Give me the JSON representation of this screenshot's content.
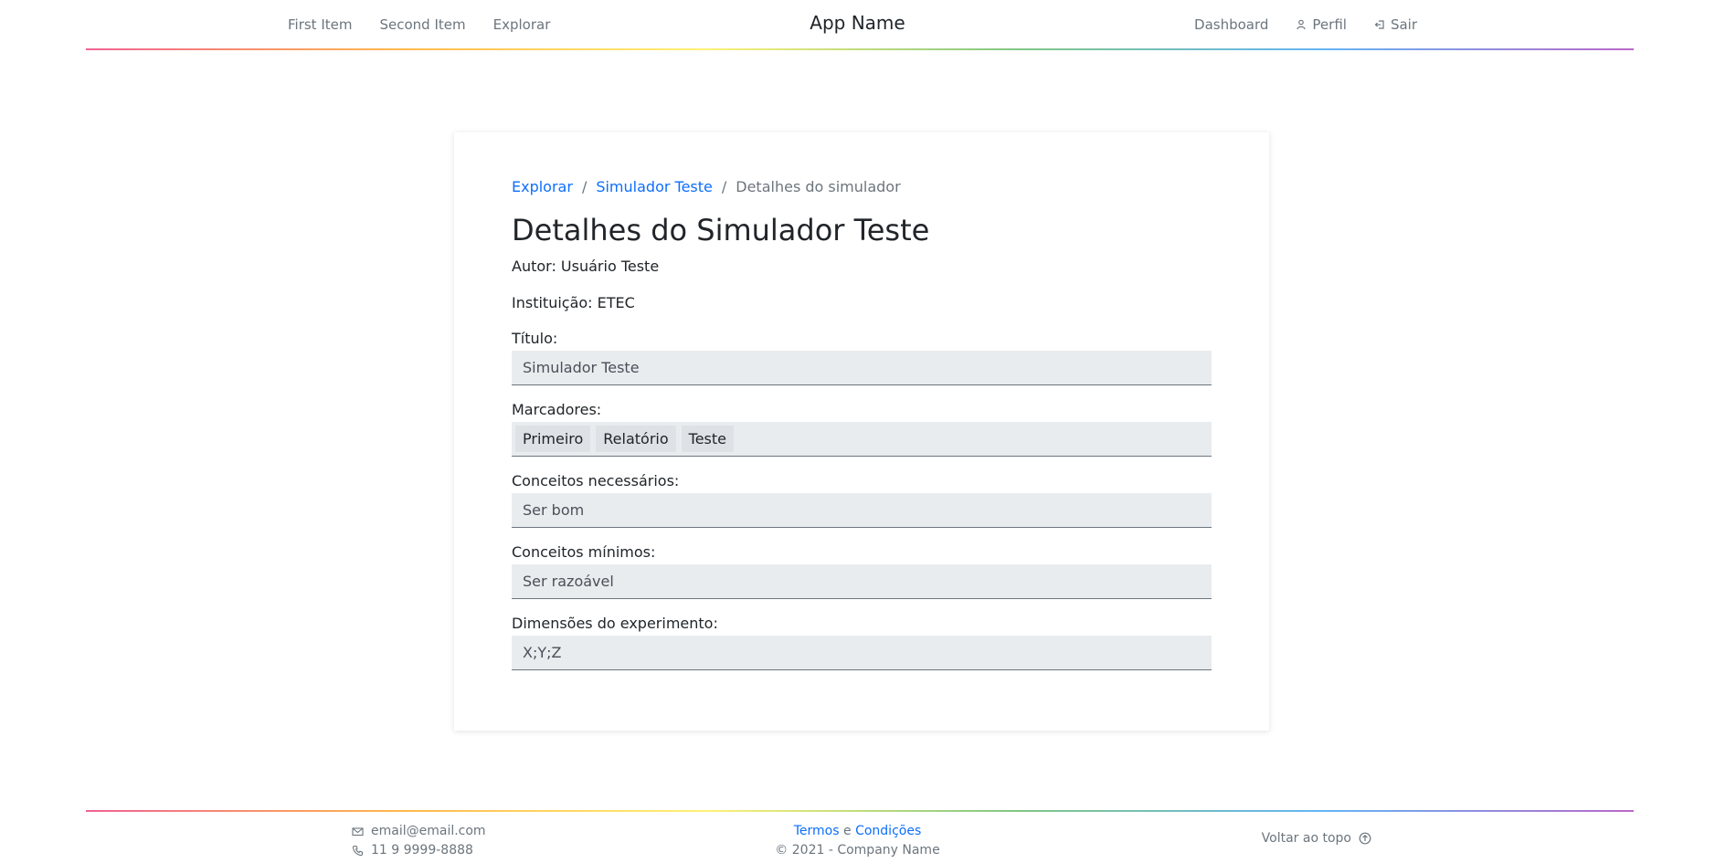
{
  "header": {
    "nav_left": [
      "First Item",
      "Second Item",
      "Explorar"
    ],
    "brand": "App Name",
    "nav_right": {
      "dashboard": "Dashboard",
      "profile": "Perfil",
      "logout": "Sair"
    }
  },
  "breadcrumb": {
    "items": [
      "Explorar",
      "Simulador Teste"
    ],
    "current": "Detalhes do simulador",
    "separator": "/"
  },
  "page": {
    "title": "Detalhes do Simulador Teste",
    "author": "Autor: Usuário Teste",
    "institution": "Instituição: ETEC"
  },
  "fields": {
    "titulo": {
      "label": "Título:",
      "value": "Simulador Teste"
    },
    "marcadores": {
      "label": "Marcadores:",
      "tags": [
        "Primeiro",
        "Relatório",
        "Teste"
      ]
    },
    "conceitos_necessarios": {
      "label": "Conceitos necessários:",
      "value": "Ser bom"
    },
    "conceitos_minimos": {
      "label": "Conceitos mínimos:",
      "value": "Ser razoável"
    },
    "dimensoes": {
      "label": "Dimensões do experimento:",
      "value": "X;Y;Z"
    }
  },
  "footer": {
    "email": "email@email.com",
    "phone": "11 9 9999-8888",
    "terms": "Termos",
    "and": "e",
    "conditions": "Condições",
    "copyright": "2021 - Company Name",
    "back_to_top": "Voltar ao topo"
  },
  "colors": {
    "accent": "#0d6efd",
    "field_bg": "#e9ecef",
    "muted_text": "#6c757d"
  }
}
